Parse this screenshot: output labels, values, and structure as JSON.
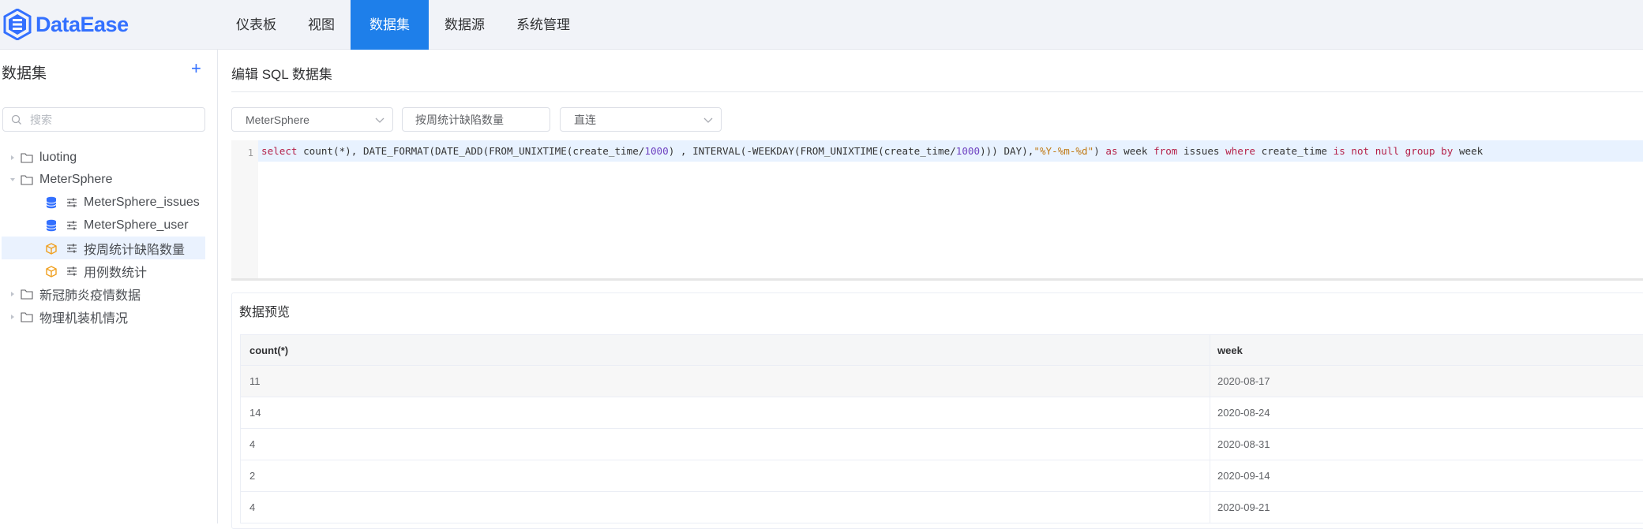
{
  "app": {
    "logo_text": "DataEase",
    "brand_color": "#3370ff",
    "nav_active_color": "#1e7fea"
  },
  "nav": {
    "items": [
      {
        "label": "仪表板",
        "active": false
      },
      {
        "label": "视图",
        "active": false
      },
      {
        "label": "数据集",
        "active": true
      },
      {
        "label": "数据源",
        "active": false
      },
      {
        "label": "系统管理",
        "active": false
      }
    ]
  },
  "sidebar": {
    "title": "数据集",
    "add_glyph": "+",
    "search_placeholder": "搜索",
    "tree": [
      {
        "label": "luoting",
        "type": "folder",
        "expanded": false
      },
      {
        "label": "MeterSphere",
        "type": "folder",
        "expanded": true
      },
      {
        "label": "MeterSphere_issues",
        "type": "db-table"
      },
      {
        "label": "MeterSphere_user",
        "type": "db-table"
      },
      {
        "label": "按周统计缺陷数量",
        "type": "sql-table",
        "selected": true
      },
      {
        "label": "用例数统计",
        "type": "sql-table"
      },
      {
        "label": "新冠肺炎疫情数据",
        "type": "folder",
        "expanded": false
      },
      {
        "label": "物理机装机情况",
        "type": "folder",
        "expanded": false
      }
    ]
  },
  "main": {
    "title": "编辑 SQL 数据集",
    "datasource_select": "MeterSphere",
    "name_input": "按周统计缺陷数量",
    "mode_select": "直连",
    "editor": {
      "line_number": "1",
      "sql": "select count(*), DATE_FORMAT(DATE_ADD(FROM_UNIXTIME(create_time/1000) , INTERVAL(-WEEKDAY(FROM_UNIXTIME(create_time/1000))) DAY),\"%Y-%m-%d\") as week from issues where create_time is not null group by week"
    },
    "preview": {
      "title": "数据预览",
      "columns": [
        "count(*)",
        "week"
      ],
      "rows": [
        [
          "11",
          "2020-08-17"
        ],
        [
          "14",
          "2020-08-24"
        ],
        [
          "4",
          "2020-08-31"
        ],
        [
          "2",
          "2020-09-14"
        ],
        [
          "4",
          "2020-09-21"
        ]
      ]
    }
  }
}
